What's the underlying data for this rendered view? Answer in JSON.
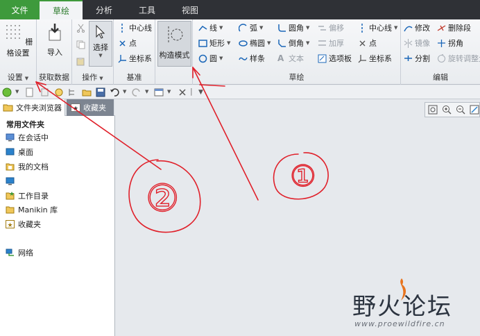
{
  "tabs": [
    {
      "label": "文件"
    },
    {
      "label": "草绘"
    },
    {
      "label": "分析"
    },
    {
      "label": "工具"
    },
    {
      "label": "视图"
    }
  ],
  "ribbon": {
    "setup": {
      "grid_label": "栅格设置",
      "group_label": "设置"
    },
    "data": {
      "import_label": "导入",
      "group_label": "获取数据"
    },
    "ops": {
      "select_label": "选择",
      "group_label": "操作"
    },
    "datum": {
      "centerline": "中心线",
      "point": "点",
      "csys": "坐标系",
      "group_label": "基准"
    },
    "construct": {
      "label": "构造模式"
    },
    "sketch": {
      "line": "线",
      "arc": "弧",
      "fillet": "圆角",
      "offset": "偏移",
      "centerline": "中心线",
      "rect": "矩形",
      "ellipse": "椭圆",
      "chamfer": "倒角",
      "thicken": "加厚",
      "point": "点",
      "circle": "圆",
      "spline": "样条",
      "text": "文本",
      "palette": "选项板",
      "csys": "坐标系",
      "group_label": "草绘"
    },
    "edit": {
      "modify": "修改",
      "delete_seg": "删除段",
      "mirror": "镜像",
      "corner": "拐角",
      "divide": "分割",
      "rotate_resize": "旋转调整大小",
      "group_label": "编辑"
    }
  },
  "panel": {
    "tab_browser": "文件夹浏览器",
    "tab_favorites": "收藏夹",
    "heading": "常用文件夹",
    "items": [
      {
        "label": "在会话中"
      },
      {
        "label": "桌面"
      },
      {
        "label": "我的文档"
      },
      {
        "label": ""
      },
      {
        "label": "工作目录"
      },
      {
        "label": "Manikin 库"
      },
      {
        "label": "收藏夹"
      },
      {
        "label": "网络"
      }
    ]
  },
  "annotations": {
    "mark1": "①",
    "mark2": "②"
  },
  "watermark": {
    "title": "野火论坛",
    "url": "www.proewildfire.cn"
  },
  "colors": {
    "file_tab": "#3e9a3c",
    "annotation": "#e0202a",
    "tabbar": "#2f3136"
  }
}
